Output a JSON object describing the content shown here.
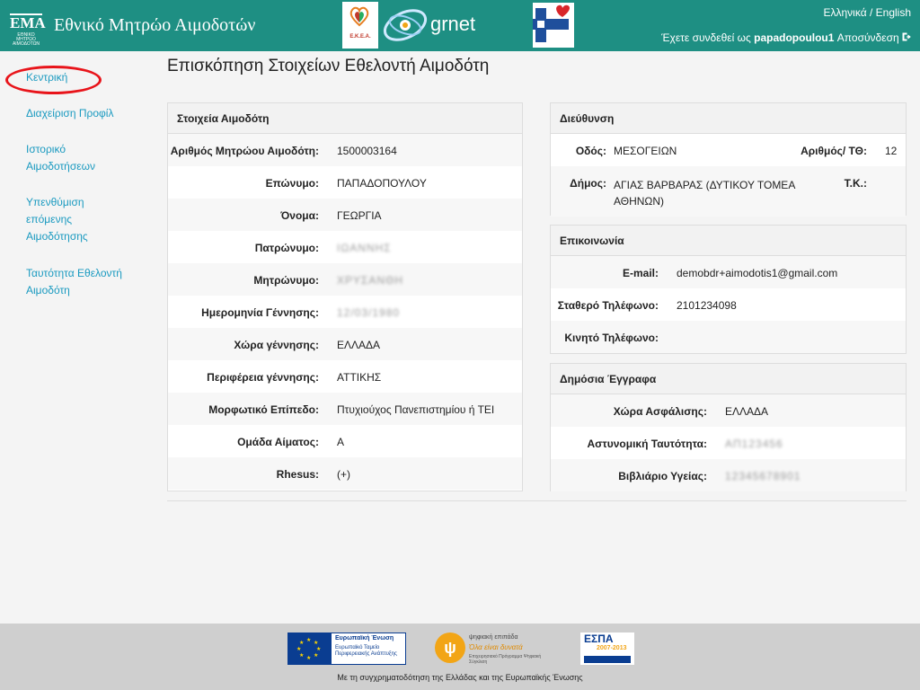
{
  "header": {
    "logo_text": "ΕΜΑ",
    "logo_subtext": "ΕΘΝΙΚΟ ΜΗΤΡΩΟ ΑΙΜΟΔΟΤΩΝ",
    "app_title": "Εθνικό Μητρώο Αιμοδοτών",
    "partner_ekea_label": "Ε.Κ.Ε.Α.",
    "partner_grnet_label": "grnet",
    "language_switch": "Ελληνικά / English",
    "login_prefix": "Έχετε συνδεθεί ως",
    "username": "papadopoulou1",
    "logout_label": "Αποσύνδεση",
    "colors": {
      "bar": "#1e8f83",
      "link": "#1a9ac0",
      "highlight_circle": "#e8141a"
    }
  },
  "sidebar": {
    "items": [
      {
        "label": "Κεντρική",
        "lines": [
          "Κεντρική"
        ]
      },
      {
        "label": "Διαχείριση Προφίλ",
        "lines": [
          "Διαχείριση Προφίλ"
        ]
      },
      {
        "label": "Ιστορικό Αιμοδοτήσεων",
        "lines": [
          "Ιστορικό",
          "Αιμοδοτήσεων"
        ]
      },
      {
        "label": "Υπενθύμιση επόμενης Αιμοδότησης",
        "lines": [
          "Υπενθύμιση",
          "επόμενης",
          "Αιμοδότησης"
        ]
      },
      {
        "label": "Ταυτότητα Εθελοντή Αιμοδότη",
        "lines": [
          "Ταυτότητα Εθελοντή",
          "Αιμοδότη"
        ]
      }
    ]
  },
  "main": {
    "page_title": "Επισκόπηση Στοιχείων Εθελοντή Αιμοδότη",
    "donor_panel": {
      "title": "Στοιχεία Αιμοδότη",
      "rows": [
        {
          "label": "Αριθμός Μητρώου Αιμοδότη:",
          "value": "1500003164",
          "blurred": false
        },
        {
          "label": "Επώνυμο:",
          "value": "ΠΑΠΑΔΟΠΟΥΛΟΥ",
          "blurred": false
        },
        {
          "label": "Όνομα:",
          "value": "ΓΕΩΡΓΙΑ",
          "blurred": false
        },
        {
          "label": "Πατρώνυμο:",
          "value": "ΙΩΑΝΝΗΣ",
          "blurred": true
        },
        {
          "label": "Μητρώνυμο:",
          "value": "ΧΡΥΣΑΝΘΗ",
          "blurred": true
        },
        {
          "label": "Ημερομηνία Γέννησης:",
          "value": "12/03/1980",
          "blurred": true
        },
        {
          "label": "Χώρα γέννησης:",
          "value": "ΕΛΛΑΔΑ",
          "blurred": false
        },
        {
          "label": "Περιφέρεια γέννησης:",
          "value": "ΑΤΤΙΚΗΣ",
          "blurred": false
        },
        {
          "label": "Μορφωτικό Επίπεδο:",
          "value": "Πτυχιούχος Πανεπιστημίου ή ΤΕΙ",
          "blurred": false
        },
        {
          "label": "Ομάδα Αίματος:",
          "value": "A",
          "blurred": false
        },
        {
          "label": "Rhesus:",
          "value": "(+)",
          "blurred": false
        }
      ]
    },
    "address_panel": {
      "title": "Διεύθυνση",
      "street_label": "Οδός:",
      "street_value": "ΜΕΣΟΓΕΙΩΝ",
      "number_label": "Αριθμός/ ΤΘ:",
      "number_value": "12",
      "municipality_label": "Δήμος:",
      "municipality_lines": [
        "ΑΓΙΑΣ ΒΑΡΒΑΡΑΣ (ΔΥΤΙΚΟΥ ΤΟΜΕΑ",
        "ΑΘΗΝΩΝ)"
      ],
      "postal_label": "Τ.Κ.:",
      "postal_value": ""
    },
    "contact_panel": {
      "title": "Επικοινωνία",
      "rows": [
        {
          "label": "E-mail:",
          "value": "demobdr+aimodotis1@gmail.com"
        },
        {
          "label": "Σταθερό Τηλέφωνο:",
          "value": "2101234098"
        },
        {
          "label": "Κινητό Τηλέφωνο:",
          "value": ""
        }
      ]
    },
    "documents_panel": {
      "title": "Δημόσια Έγγραφα",
      "rows": [
        {
          "label": "Χώρα Ασφάλισης:",
          "value": "ΕΛΛΑΔΑ",
          "blurred": false
        },
        {
          "label": "Αστυνομική Ταυτότητα:",
          "value": "ΑΠ123456",
          "blurred": true
        },
        {
          "label": "Βιβλιάριο Υγείας:",
          "value": "12345678901",
          "blurred": true
        }
      ]
    }
  },
  "footer": {
    "eu_title": "Ευρωπαϊκή Ένωση",
    "eu_fund": "Ευρωπαϊκό Ταμείο Περιφερειακής Ανάπτυξης",
    "digital_top": "ψηφιακή επιπάδα",
    "digital_slogan": "Όλα είναι δυνατά",
    "digital_program": "Επιχειρησιακό Πρόγραμμα Ψηφιακή Σύγκλιση",
    "espa_label": "ΕΣΠΑ",
    "espa_years": "2007-2013",
    "caption": "Με τη συγχρηματοδότηση της Ελλάδας και της Ευρωπαϊκής Ένωσης"
  }
}
